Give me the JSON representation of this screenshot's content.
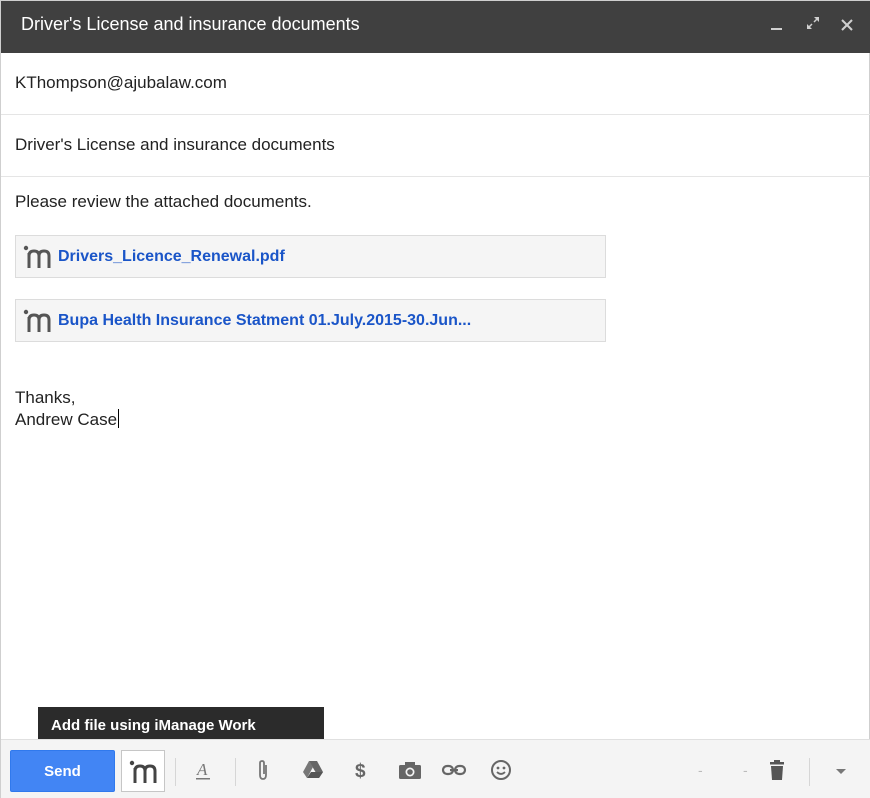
{
  "window": {
    "title": "Driver's License and insurance documents",
    "controls": [
      "minimize-icon",
      "expand-icon",
      "close-icon"
    ]
  },
  "to": {
    "value": "KThompson@ajubalaw.com"
  },
  "subject": {
    "value": "Driver's License and insurance documents"
  },
  "body": {
    "intro": "Please review the attached documents.",
    "attachments": [
      {
        "name": "Drivers_Licence_Renewal.pdf",
        "icon": "imanage-icon"
      },
      {
        "name": "Bupa Health Insurance Statment 01.July.2015-30.Jun...",
        "icon": "imanage-icon"
      }
    ],
    "closing": "Thanks,",
    "signature": "Andrew Case"
  },
  "tooltip": {
    "text": "Add file using iManage Work"
  },
  "toolbar": {
    "send_label": "Send",
    "buttons": [
      "imanage-icon",
      "text-format-icon",
      "attach-icon",
      "drive-icon",
      "dollar-icon",
      "camera-icon",
      "link-icon",
      "emoji-icon",
      "trash-icon",
      "more-options-icon"
    ],
    "colors": {
      "send": "#4285f4",
      "link": "#1a55c8",
      "titlebar": "#404040"
    }
  }
}
